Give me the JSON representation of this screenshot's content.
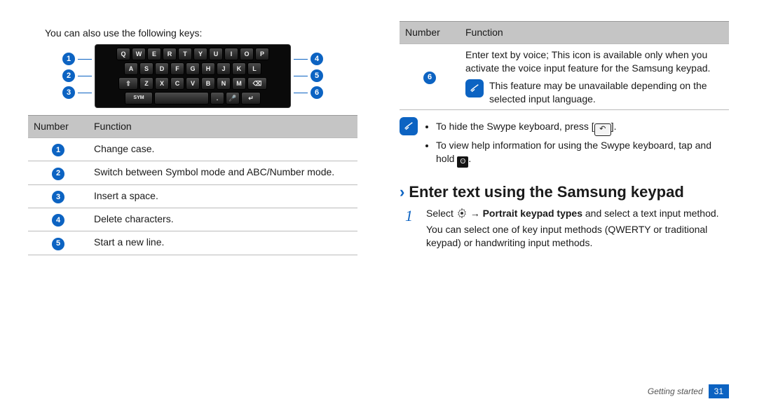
{
  "left": {
    "intro": "You can also use the following keys:",
    "table": {
      "headers": [
        "Number",
        "Function"
      ],
      "rows": [
        {
          "num": "1",
          "text": "Change case."
        },
        {
          "num": "2",
          "text": "Switch between Symbol mode and ABC/Number mode."
        },
        {
          "num": "3",
          "text": "Insert a space."
        },
        {
          "num": "4",
          "text": "Delete characters."
        },
        {
          "num": "5",
          "text": "Start a new line."
        }
      ]
    },
    "callouts_left": [
      "1",
      "2",
      "3"
    ],
    "callouts_right": [
      "4",
      "5",
      "6"
    ]
  },
  "right": {
    "table": {
      "headers": [
        "Number",
        "Function"
      ],
      "row6_main": "Enter text by voice; This icon is available only when you activate the voice input feature for the Samsung keypad.",
      "row6_note": "This feature may be unavailable depending on the selected input language.",
      "row6_num": "6"
    },
    "tips": {
      "line1_before": "To hide the Swype keyboard, press [",
      "line1_after": "].",
      "line2_before": "To view help information for using the Swype keyboard, tap and hold ",
      "line2_after": "."
    },
    "heading": "Enter text using the Samsung keypad",
    "step1_before": "Select ",
    "step1_mid": " → ",
    "step1_bold": "Portrait keypad types",
    "step1_after": " and select a text input method.",
    "step1_body": "You can select one of key input methods (QWERTY or traditional keypad) or handwriting input methods."
  },
  "footer": {
    "section": "Getting started",
    "page": "31"
  }
}
